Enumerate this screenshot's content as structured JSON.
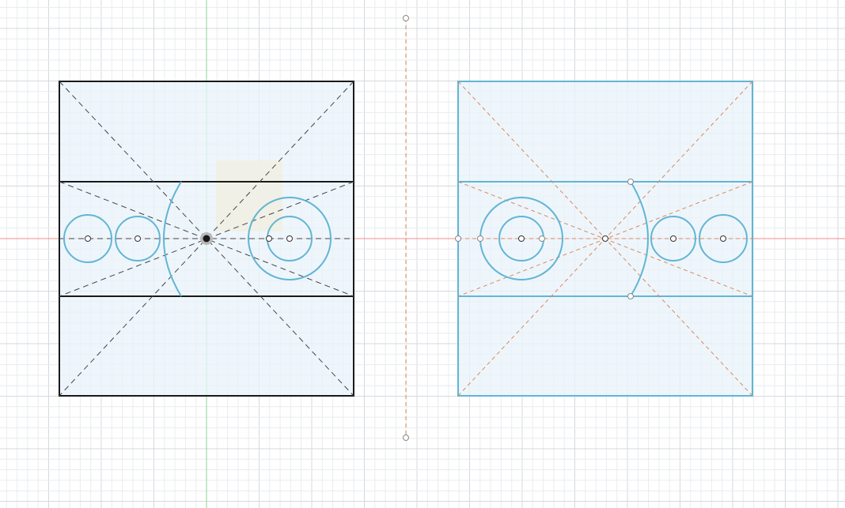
{
  "workspace": {
    "mode": "sketch"
  },
  "colors": {
    "background": "#ffffff",
    "grid_minor": "#e9ecef",
    "grid_major": "#d5d9de",
    "x_axis": "#f08c8c",
    "y_axis": "#8fd68f",
    "profile_fill": "#e8f3fb",
    "original_outline": "#1a1a1a",
    "mirrored_outline": "#62b5d4",
    "construction_original": "#444444",
    "construction_mirror": "#d9895e"
  },
  "icons": {
    "origin": "origin-point-icon",
    "sketch_point": "sketch-point-icon"
  }
}
